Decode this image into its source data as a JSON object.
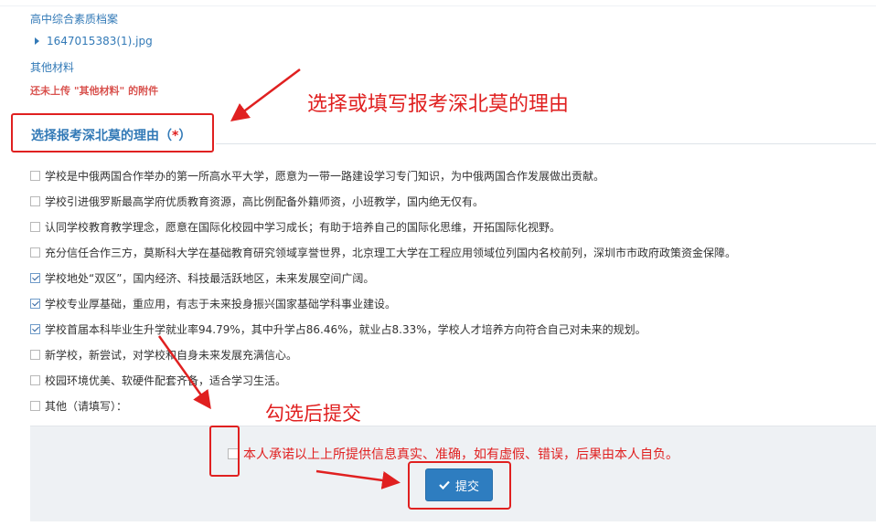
{
  "header": {
    "section_label": "高中综合素质档案",
    "file_name": "1647015383(1).jpg",
    "other_materials_label": "其他材料",
    "missing_upload_warning": "还未上传 \"其他材料\" 的附件"
  },
  "annotations": {
    "reason_hint": "选择或填写报考深北莫的理由",
    "submit_hint": "勾选后提交"
  },
  "reason_section": {
    "title": "选择报考深北莫的理由（",
    "required_mark": "*",
    "title_close": "）",
    "options": [
      {
        "label": "学校是中俄两国合作举办的第一所高水平大学，愿意为一带一路建设学习专门知识，为中俄两国合作发展做出贡献。",
        "checked": false
      },
      {
        "label": "学校引进俄罗斯最高学府优质教育资源，高比例配备外籍师资，小班教学，国内绝无仅有。",
        "checked": false
      },
      {
        "label": "认同学校教育教学理念，愿意在国际化校园中学习成长；有助于培养自己的国际化思维，开拓国际化视野。",
        "checked": false
      },
      {
        "label": "充分信任合作三方，莫斯科大学在基础教育研究领域享誉世界，北京理工大学在工程应用领域位列国内名校前列，深圳市市政府政策资金保障。",
        "checked": false
      },
      {
        "label": "学校地处“双区”，国内经济、科技最活跃地区，未来发展空间广阔。",
        "checked": true
      },
      {
        "label": "学校专业厚基础，重应用，有志于未来投身振兴国家基础学科事业建设。",
        "checked": true
      },
      {
        "label": "学校首届本科毕业生升学就业率94.79%，其中升学占86.46%，就业占8.33%，学校人才培养方向符合自己对未来的规划。",
        "checked": true
      },
      {
        "label": "新学校，新尝试，对学校和自身未来发展充满信心。",
        "checked": false
      },
      {
        "label": "校园环境优美、软硬件配套齐备，适合学习生活。",
        "checked": false
      },
      {
        "label": "其他（请填写）：",
        "checked": false
      }
    ]
  },
  "footer": {
    "pledge_text": "本人承诺以上上所提供信息真实、准确，如有虚假、错误，后果由本人自负。",
    "submit_label": "提交"
  },
  "colors": {
    "annotation_red": "#e02020",
    "link_blue": "#337ab7",
    "button_blue": "#2e7dc0",
    "panel_gray": "#eef1f4"
  }
}
